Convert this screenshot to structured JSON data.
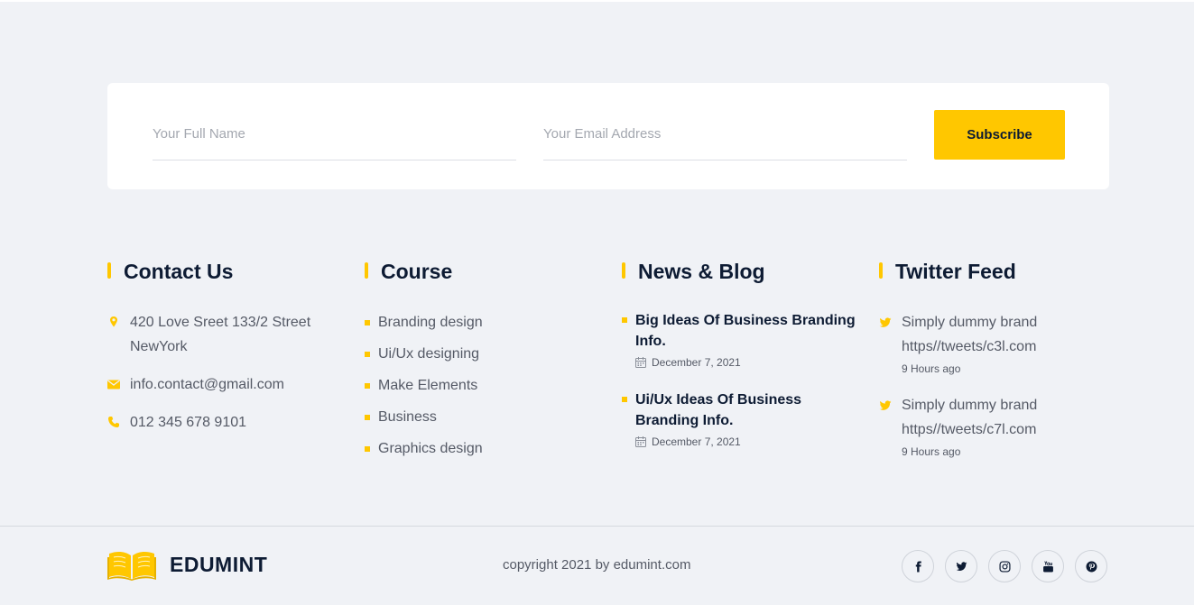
{
  "subscribe": {
    "name_placeholder": "Your Full Name",
    "email_placeholder": "Your Email Address",
    "button_label": "Subscribe"
  },
  "contact": {
    "title": "Contact Us",
    "address_line1": "420 Love Sreet 133/2 Street",
    "address_line2": "NewYork",
    "email": "info.contact@gmail.com",
    "phone": "012 345 678 9101",
    "icons": [
      "map-pin-icon",
      "envelope-icon",
      "phone-icon"
    ]
  },
  "course": {
    "title": "Course",
    "items": [
      "Branding design",
      "Ui/Ux designing",
      "Make Elements",
      "Business",
      "Graphics design"
    ]
  },
  "news": {
    "title": "News & Blog",
    "items": [
      {
        "title": "Big Ideas Of Business Branding Info.",
        "date": "December 7, 2021"
      },
      {
        "title": "Ui/Ux Ideas Of Business Branding Info.",
        "date": "December 7, 2021"
      }
    ]
  },
  "twitter": {
    "title": "Twitter Feed",
    "items": [
      {
        "text": "Simply dummy brand",
        "link": "https//tweets/c3l.com",
        "time": "9 Hours ago"
      },
      {
        "text": "Simply dummy brand",
        "link": "https//tweets/c7l.com",
        "time": "9 Hours ago"
      }
    ]
  },
  "footer": {
    "brand": "EDUMINT",
    "copyright": "copyright 2021 by edumint.com",
    "social_icons": [
      "facebook-icon",
      "twitter-icon",
      "instagram-icon",
      "youtube-icon",
      "pinterest-icon"
    ]
  },
  "colors": {
    "accent": "#ffc700",
    "heading": "#0d1b33",
    "text": "#555a66",
    "background": "#f0f2f6"
  }
}
